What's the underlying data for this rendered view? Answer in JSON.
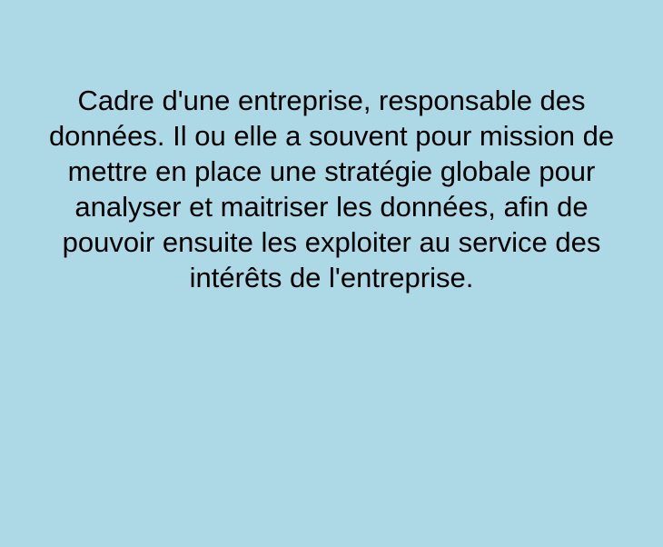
{
  "card": {
    "background_color": "#add8e6",
    "text_color": "#000000",
    "definition": "Cadre d'une entreprise, responsable des données. Il ou elle a souvent pour mission de mettre en place une stratégie globale pour analyser et maitriser les données, afin de pouvoir ensuite les exploiter au service des intérêts de l'entreprise."
  }
}
